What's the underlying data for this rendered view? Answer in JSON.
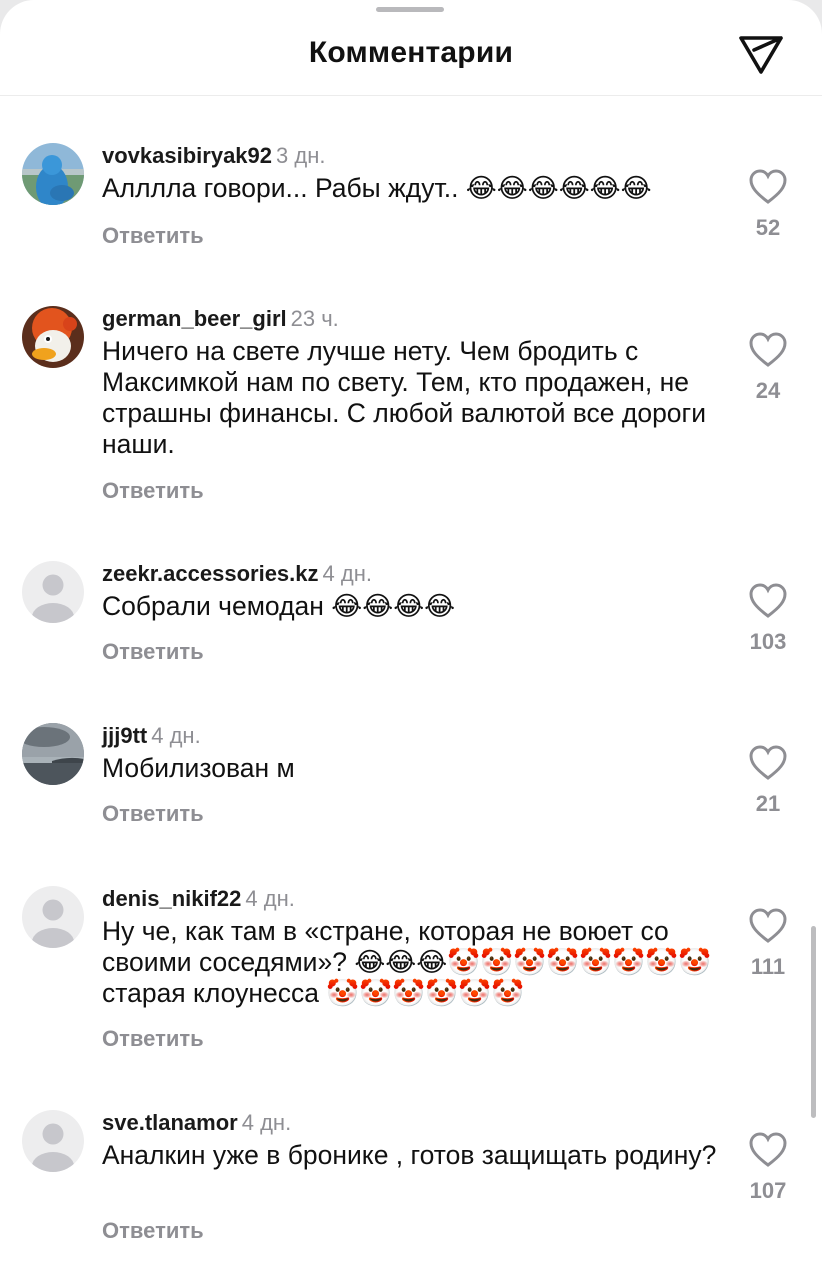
{
  "header": {
    "title": "Комментарии",
    "send_icon": "paper-plane-icon"
  },
  "reply_label": "Ответить",
  "like_icon": "heart-outline-icon",
  "colors": {
    "secondary_text": "#8e8e93",
    "primary_text": "#111111",
    "background": "#ffffff"
  },
  "comments": [
    {
      "username": "vovkasibiryak92",
      "time": "3 дн.",
      "text": "Алллла говори... Рабы ждут.. 😂😂😂😂😂😂",
      "likes": "52",
      "avatar": "photo-blue-hood"
    },
    {
      "username": "german_beer_girl",
      "time": "23 ч.",
      "text": "Ничего на свете лучше нету. Чем бродить с Максимкой нам по свету. Тем, кто продажен, не страшны финансы. С любой валютой все дороги наши.",
      "likes": "24",
      "avatar": "cartoon-duck"
    },
    {
      "username": "zeekr.accessories.kz",
      "time": "4 дн.",
      "text": "Собрали чемодан 😂😂😂😂",
      "likes": "103",
      "avatar": "default-user"
    },
    {
      "username": "jjj9tt",
      "time": "4 дн.",
      "text": "Мобилизован м",
      "likes": "21",
      "avatar": "photo-sea-sky"
    },
    {
      "username": "denis_nikif22",
      "time": "4 дн.",
      "text": "Ну че, как там в «стране, которая не воюет со своими соседями»? 😂😂😂🤡🤡🤡🤡🤡🤡🤡🤡 старая клоунесса 🤡🤡🤡🤡🤡🤡",
      "likes": "111",
      "avatar": "default-user"
    },
    {
      "username": "sve.tlanamor",
      "time": "4 дн.",
      "text": "Аналкин уже в бронике , готов защищать родину?",
      "likes": "107",
      "avatar": "default-user"
    }
  ]
}
